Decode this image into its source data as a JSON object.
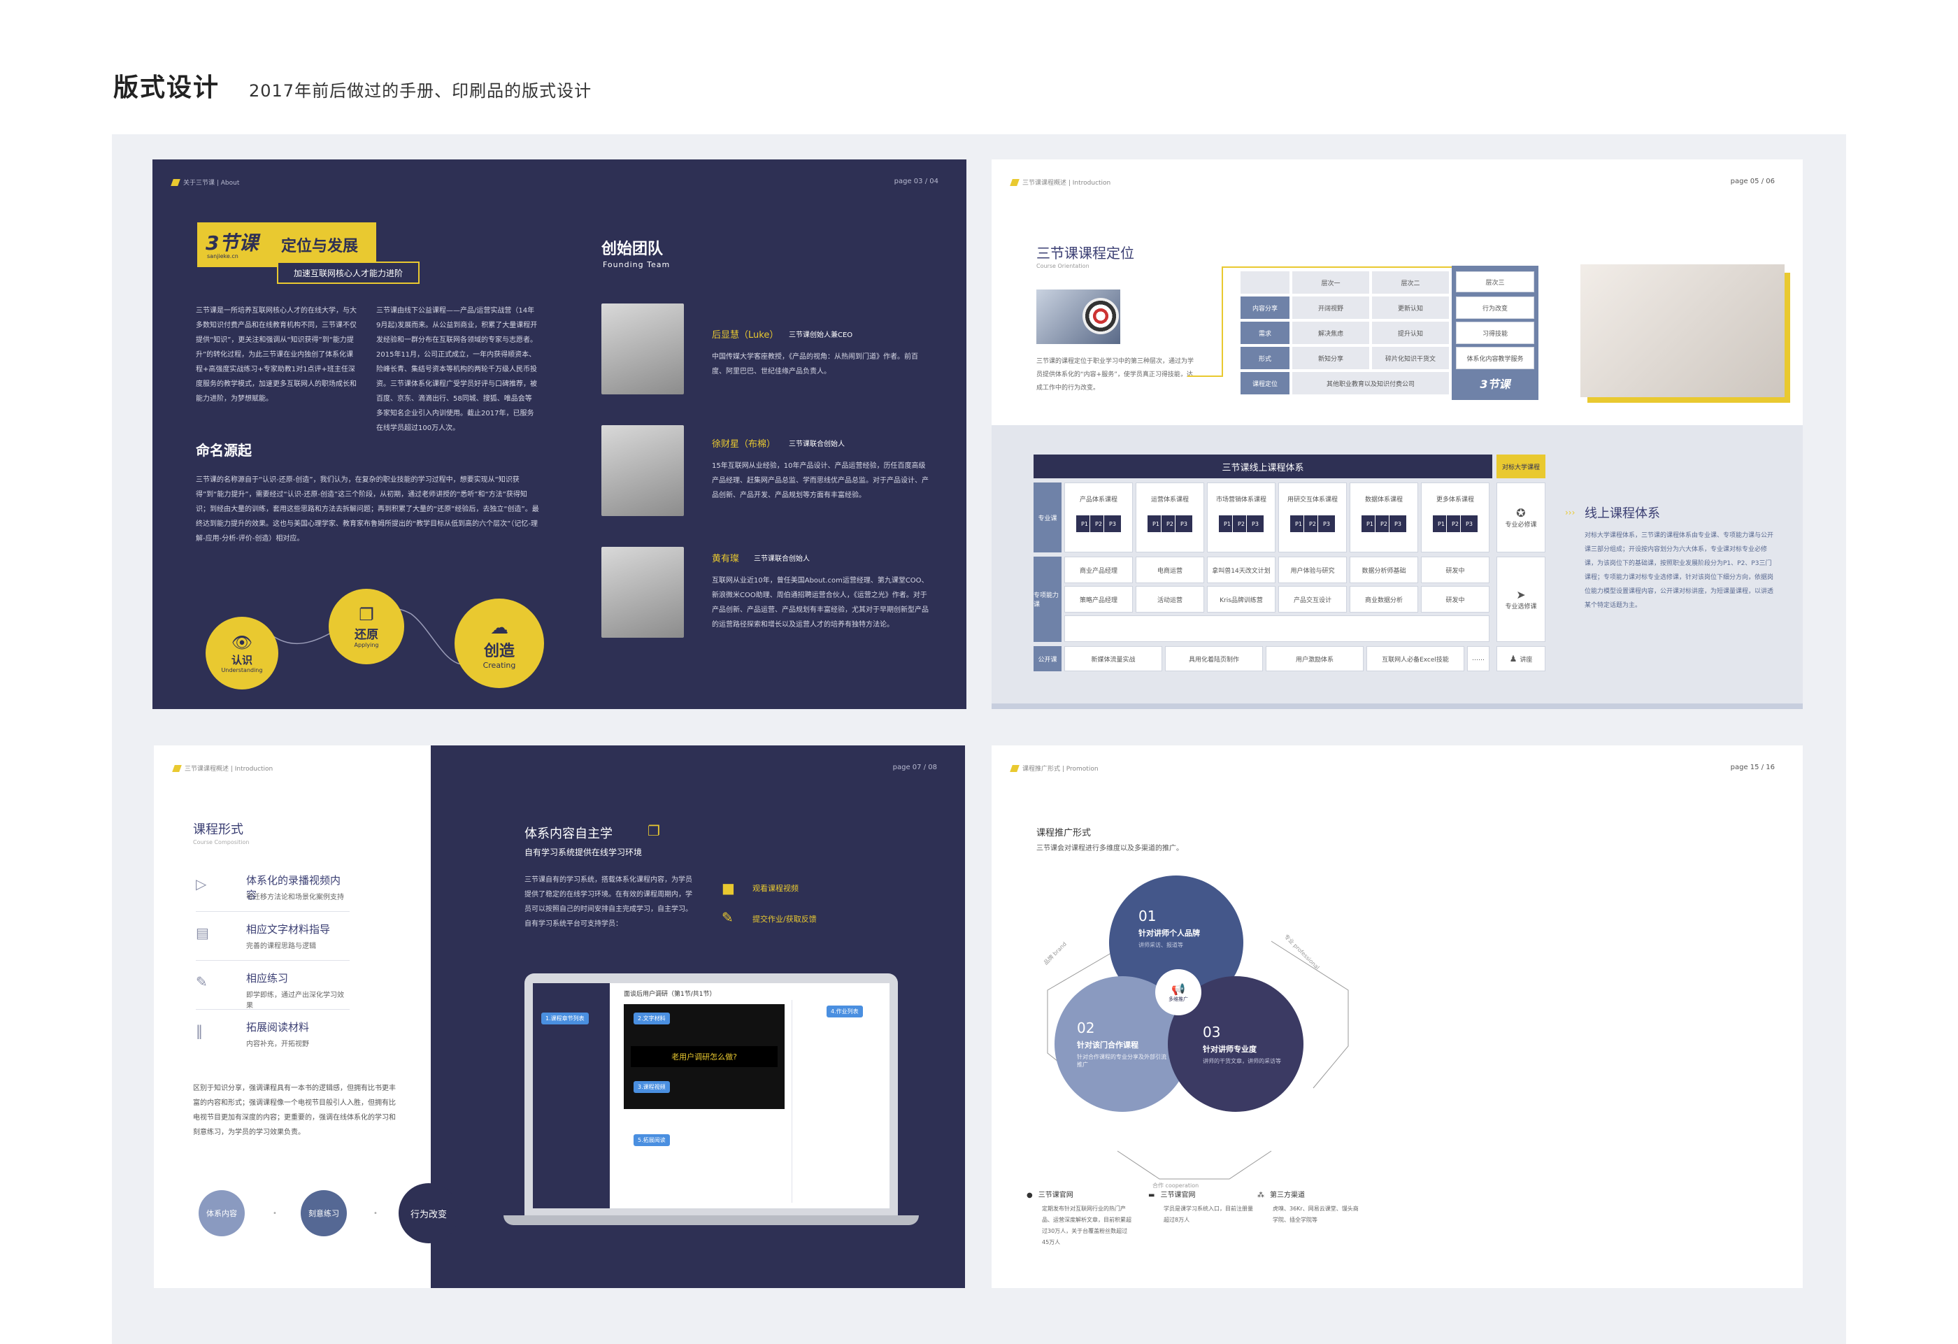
{
  "heading": "版式设计",
  "subheading": "2017年前后做过的手册、印刷品的版式设计",
  "p1": {
    "crumb": "关于三节课 | About",
    "page": "page 03 / 04",
    "logo": "3节课",
    "logo_url": "sanjieke.cn",
    "title": "定位与发展",
    "tagline": "加速互联网核心人才能力进阶",
    "para1": "三节课是一所培养互联网核心人才的在线大学，与大多数知识付费产品和在线教育机构不同，三节课不仅提供“知识”，更关注和强调从“知识获得”到“能力提升”的转化过程，为此三节课在业内独创了体系化课程+高强度实战练习+专家助教1对1点评+班主任深度服务的教学模式，加速更多互联网人的职场成长和能力进阶，为梦想赋能。",
    "para2": "三节课由线下公益课程——产品/运营实战营（14年9月起)发展而来。从公益到商业，积累了大量课程开发经验和一群分布在互联网各领域的专家与志愿者。2015年11月，公司正式成立，一年内获得顺资本、险峰长青、集结号资本等机构的两轮千万级人民币投资。三节课体系化课程广受学员好评与口碑推荐，被百度、京东、滴滴出行、58同城、搜狐、唯品会等多家知名企业引入内训使用。截止2017年，已服务在线学员超过100万人次。",
    "naming_title": "命名源起",
    "naming_para": "三节课的名称源自于“认识-还原-创造”，我们认为，在复杂的职业技能的学习过程中，想要实现从“知识获得”到“能力提升”，需要经过“认识-还原-创造”这三个阶段，从初期，通过老师讲授的“悉听”和“方法”获得知识；到经由大量的训练，套用这些思路和方法去拆解问题；再到积累了大量的“还原”经验后，去独立“创造”。最终达到能力提升的效果。这也与美国心理学家、教育家布鲁姆所提出的“教学目标从低到高的六个层次”（记忆-理解-应用-分析-评价-创造）相对应。",
    "stages": [
      {
        "cn": "认识",
        "en": "Understanding"
      },
      {
        "cn": "还原",
        "en": "Applying"
      },
      {
        "cn": "创造",
        "en": "Creating"
      }
    ],
    "team_title": "创始团队",
    "team_en": "Founding Team",
    "members": [
      {
        "name": "后显慧（Luke）",
        "role": "三节课创始人兼CEO",
        "bio": "中国传媒大学客座教授，《产品的视角：从热闹到门道》作者。前百度、阿里巴巴、世纪佳缘产品负责人。"
      },
      {
        "name": "徐财星（布棉）",
        "role": "三节课联合创始人",
        "bio": "15年互联网从业经验，10年产品设计、产品运营经验，历任百度高级产品经理、赶集网产品总监、学而思线优产品总监。对于产品设计、产品创新、产品开发、产品规划等方面有丰富经验。"
      },
      {
        "name": "黄有璨",
        "role": "三节课联合创始人",
        "bio": "互联网从业近10年，曾任美国About.com运营经理、第九课堂COO、新浪微米COO助理、周伯通招聘运营合伙人，《运营之光》作者。对于产品创新、产品运营、产品规划有丰富经验，尤其对于早期创新型产品的运营路径探索和增长以及运营人才的培养有独特方法论。"
      }
    ]
  },
  "p2": {
    "crumb": "三节课课程概述 | Introduction",
    "page": "page 05 / 06",
    "title": "三节课课程定位",
    "title_en": "Course Orientation",
    "desc": "三节课的课程定位于职业学习中的第三种层次，通过为学员提供体系化的“内容+服务”，使学员真正习得技能，达成工作中的行为改变。",
    "matrix_headers": [
      "层次一",
      "层次二",
      "层次三"
    ],
    "matrix_rows": [
      {
        "label": "内容分享",
        "a": "开阔视野",
        "b": "更新认知",
        "c": "行为改变"
      },
      {
        "label": "需求",
        "a": "解决焦虑",
        "b": "提升认知",
        "c": "习得技能"
      },
      {
        "label": "形式",
        "a": "新知分享",
        "b": "碎片化知识干货文",
        "c": "体系化内容教学服务"
      },
      {
        "label": "课程定位",
        "a": "其他职业教育以及知识付费公司",
        "b": "",
        "c": "3节课"
      }
    ],
    "system_title": "三节课线上课程体系",
    "system_tag": "对标大学课程",
    "row_labels": [
      "专业课",
      "专项能力课",
      "公开课"
    ],
    "pro_courses": [
      "产品体系课程",
      "运营体系课程",
      "市场营销体系课程",
      "用研交互体系课程",
      "数据体系课程",
      "更多体系课程"
    ],
    "chips": [
      "P1",
      "P2",
      "P3"
    ],
    "skill_rows": [
      [
        "商业产品经理",
        "电商运营",
        "拿叫兽14天改文计划",
        "用户体验与研究",
        "数据分析师基础",
        "研发中"
      ],
      [
        "策略产品经理",
        "活动运营",
        "Kris品牌训练营",
        "产品交互设计",
        "商业数据分析",
        "研发中"
      ]
    ],
    "open_courses": [
      "新媒体流量实战",
      "具用化着陆页制作",
      "用户激励体系",
      "互联网人必备Excel技能",
      "……"
    ],
    "side_labels": [
      "专业必修课",
      "专业选修课",
      "讲座"
    ],
    "online_title": "线上课程体系",
    "online_para": "对标大学课程体系，三节课的课程体系由专业课、专项能力课与公开课三部分组成；开设按内容划分为六大体系，专业课对标专业必修课，为该岗位下的基础课，按照职业发展阶段分为P1、P2、P3三门课程；专项能力课对标专业选修课，针对该岗位下细分方向，依据岗位能力模型设置课程内容，公开课对标讲座，为短课量课程，以讲透某个特定话题为主。"
  },
  "p3": {
    "crumb": "三节课课程概述 | Introduction",
    "page": "page 07 / 08",
    "title": "课程形式",
    "title_en": "Course Composition",
    "formats": [
      {
        "t": "体系化的录播视频内容",
        "s": "可迁移方法论和场景化案例支持"
      },
      {
        "t": "相应文字材料指导",
        "s": "完善的课程思路与逻辑"
      },
      {
        "t": "相应练习",
        "s": "即学即练，通过产出深化学习效果"
      },
      {
        "t": "拓展阅读材料",
        "s": "内容补充，开拓视野"
      }
    ],
    "para": "区别于知识分享，强调课程具有一本书的逻辑感，但拥有比书更丰富的内容和形式；强调课程像一个电视节目般引人入胜，但拥有比电视节目更加有深度的内容；更重要的，强调在线体系化的学习和刻意练习，为学员的学习效果负责。",
    "flow": [
      "体系内容",
      "刻意练习",
      "行为改变"
    ],
    "right_title": "体系内容自主学",
    "right_sub": "自有学习系统提供在线学习环境",
    "right_para": "三节课自有的学习系统，搭载体系化课程内容，为学员提供了稳定的在线学习环境。在有效的课程周期内，学员可以按照自己的时间安排自主完成学习，自主学习。自有学习系统平台可支持学员：",
    "features": [
      "观看课程视频",
      "提交作业/获取反馈"
    ],
    "screen_title": "面谈后用户调研（第1节/共1节）",
    "screen_banner": "老用户调研怎么做?",
    "callouts": [
      "1.课程章节列表",
      "2.文字材料",
      "3.课程视频",
      "4.作业列表",
      "5.拓展阅读"
    ]
  },
  "p4": {
    "crumb": "课程推广形式 | Promotion",
    "page": "page 15 / 16",
    "title": "课程推广形式",
    "desc": "三节课会对课程进行多维度以及多渠道的推广。",
    "circles": [
      {
        "num": "01",
        "t": "针对讲师个人品牌",
        "s": "讲师采访、报道等"
      },
      {
        "num": "02",
        "t": "针对该门合作课程",
        "s": "针对合作课程的专业分享及外部引流推广"
      },
      {
        "num": "03",
        "t": "针对讲师专业度",
        "s": "讲师的干货文章，讲师的采访等"
      }
    ],
    "center": "多维推广",
    "arcs": [
      "品牌 brand",
      "专业 professional",
      "合作 cooperation"
    ],
    "channels": [
      {
        "t": "三节课官网",
        "s": "定期发布针对互联网行业的热门产品、运营深度解析文章，目前积累超过30万人，关于台覆盖粉丝数超过45万人"
      },
      {
        "t": "三节课官网",
        "s": "学员是课学习系统入口，目前注册量超过8万人"
      },
      {
        "t": "第三方渠道",
        "s": "虎嗅、36Kr、网易云课堂、馒头商学院、插全学院等"
      }
    ]
  }
}
